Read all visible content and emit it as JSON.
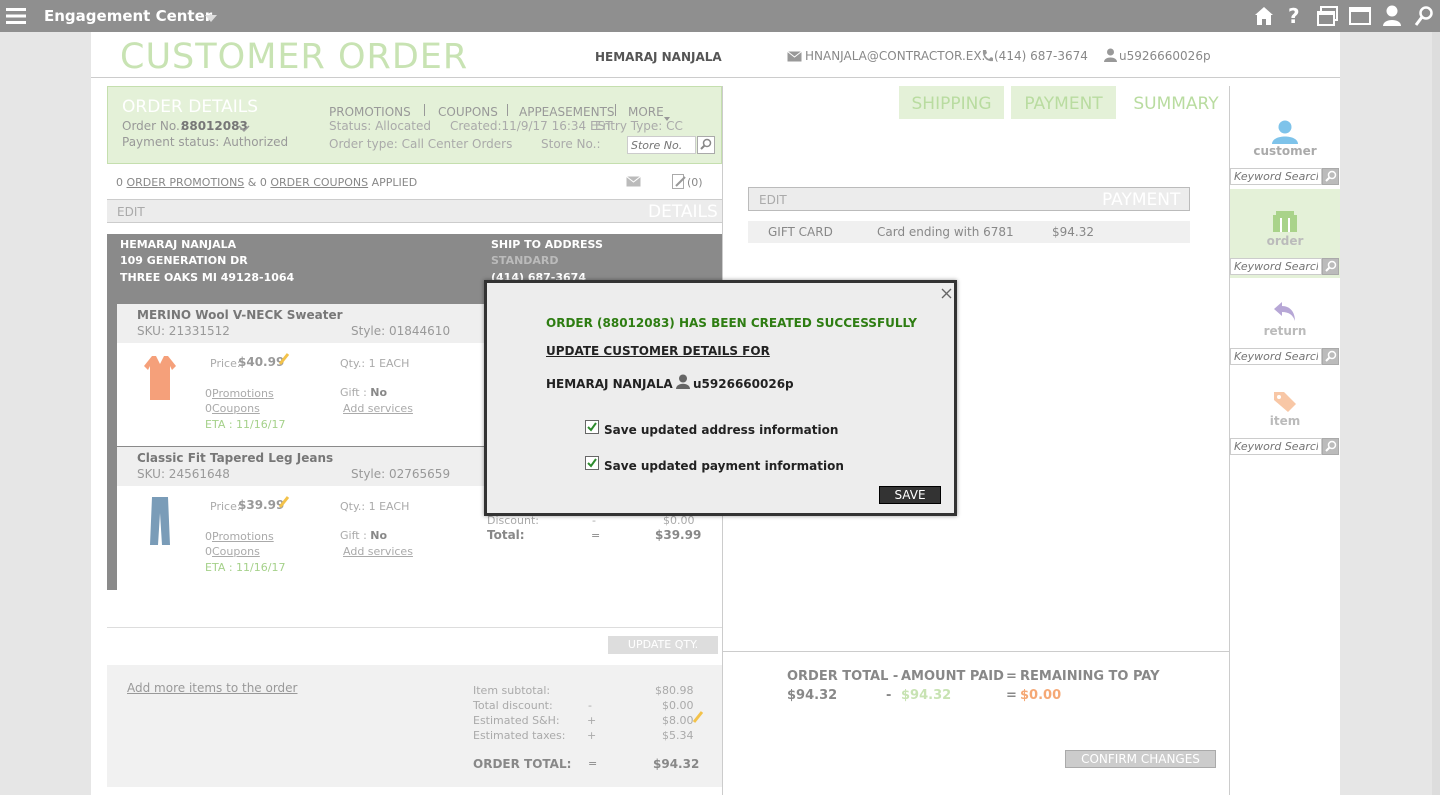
{
  "topbar": {
    "title": "Engagement Center"
  },
  "header": {
    "page_title": "CUSTOMER ORDER",
    "customer_name": "HEMARAJ NANJALA",
    "email": "HNANJALA@CONTRACTOR.EX...",
    "phone": "(414) 687-3674",
    "user_id": "u5926660026p"
  },
  "order_details": {
    "title": "ORDER DETAILS",
    "order_no_label": "Order No.:",
    "order_no": "88012083",
    "payment_status": "Payment status: Authorized",
    "menu": [
      "PROMOTIONS",
      "COUPONS",
      "APPEASEMENTS",
      "MORE"
    ],
    "status": "Status:  Allocated",
    "created": "Created:11/9/17 16:34 EST",
    "entry_type": "Entry Type: CC",
    "order_type": "Order type:  Call Center Orders",
    "store_no_label": "Store No.:",
    "store_placeholder": "Store No."
  },
  "promo_line": {
    "count1": "0",
    "promos": "ORDER PROMOTIONS",
    "amp": "&",
    "count2": "0",
    "coupons": "ORDER COUPONS",
    "applied": "APPLIED",
    "notes": "(0)"
  },
  "details_bar": {
    "edit": "EDIT",
    "label": "DETAILS"
  },
  "shipping": {
    "name": "HEMARAJ NANJALA",
    "address1": "109 GENERATION DR",
    "address2": "THREE OAKS MI 49128-1064",
    "ship_label": "SHIP TO ADDRESS",
    "method": "STANDARD",
    "phone": "(414) 687-3674"
  },
  "items": [
    {
      "name": "MERINO Wool V-NECK Sweater",
      "sku": "SKU: 21331512",
      "style": "Style: 01844610",
      "price_label": "Price:",
      "price": "$40.99",
      "qty": "Qty.:  1  EACH",
      "promos": "Promotions",
      "promos_count": "0",
      "coupons": "Coupons",
      "coupons_count": "0",
      "gift_label": "Gift :",
      "gift": "No",
      "services": "Add services",
      "eta": "ETA : 11/16/17"
    },
    {
      "name": "Classic Fit Tapered Leg Jeans",
      "sku": "SKU: 24561648",
      "style": "Style: 02765659",
      "price_label": "Price:",
      "price": "$39.99",
      "qty": "Qty.:  1  EACH",
      "promos": "Promotions",
      "promos_count": "0",
      "coupons": "Coupons",
      "coupons_count": "0",
      "gift_label": "Gift :",
      "gift": "No",
      "services": "Add services",
      "eta": "ETA : 11/16/17",
      "discount_label": "Discount:",
      "discount_op": "-",
      "discount": "$0.00",
      "total_label": "Total:",
      "total_op": "=",
      "total": "$39.99"
    }
  ],
  "update_qty": "UPDATE QTY.",
  "add_more": "Add more items to the order",
  "summary": {
    "rows": [
      {
        "label": "Item subtotal:",
        "op": "",
        "value": "$80.98"
      },
      {
        "label": "Total discount:",
        "op": "-",
        "value": "$0.00"
      },
      {
        "label": "Estimated S&H:",
        "op": "+",
        "value": "$8.00"
      },
      {
        "label": "Estimated taxes:",
        "op": "+",
        "value": "$5.34"
      }
    ],
    "order_total_label": "ORDER TOTAL:",
    "order_total_op": "=",
    "order_total": "$94.32"
  },
  "tabs": [
    "SHIPPING",
    "PAYMENT",
    "SUMMARY"
  ],
  "payment_bar": {
    "edit": "EDIT",
    "label": "PAYMENT"
  },
  "payment_row": {
    "type": "GIFT CARD",
    "card": "Card ending with 6781",
    "amount": "$94.32"
  },
  "totals": {
    "order_total_label": "ORDER TOTAL -",
    "amount_paid_label": "AMOUNT PAID",
    "eq": "=",
    "remaining_label": "REMAINING TO PAY",
    "order_total": "$94.32",
    "minus": "-",
    "amount_paid": "$94.32",
    "remaining": "$0.00"
  },
  "confirm": "CONFIRM CHANGES",
  "sidebar": [
    {
      "label": "customer",
      "placeholder": "Keyword Search"
    },
    {
      "label": "order",
      "placeholder": "Keyword Search"
    },
    {
      "label": "return",
      "placeholder": "Keyword Search"
    },
    {
      "label": "item",
      "placeholder": "Keyword Search"
    }
  ],
  "dialog": {
    "success": "ORDER (88012083) HAS BEEN CREATED SUCCESSFULLY",
    "update_title": "UPDATE CUSTOMER DETAILS FOR",
    "name": "HEMARAJ NANJALA",
    "user_id": "u5926660026p",
    "cb_address": "Save updated address information",
    "cb_payment": "Save updated payment information",
    "save": "SAVE"
  },
  "colors": {
    "accent_green": "#6cac4a",
    "topbar": "#8f8f8f",
    "order_panel": "#e4f1d8"
  }
}
